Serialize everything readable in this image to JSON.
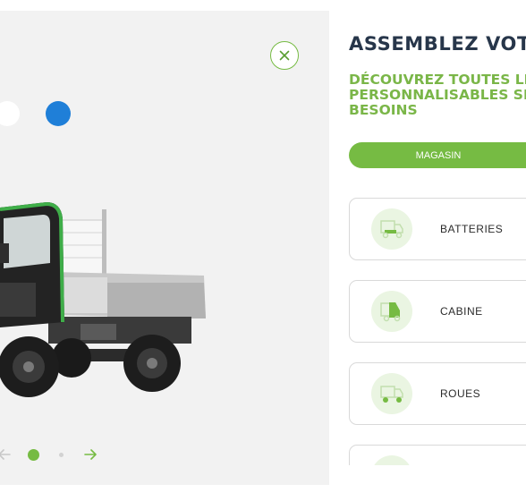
{
  "configurator": {
    "title": "ASSEMBLEZ VOTRE",
    "subtitle_lines": [
      "DÉCOUVREZ TOUTES LES OPTIONS",
      "PERSONNALISABLES SELON VOS",
      "BESOINS"
    ],
    "store_button_label": "MAGASIN",
    "options": [
      {
        "label": "BATTERIES",
        "icon": "battery-truck-icon"
      },
      {
        "label": "CABINE",
        "icon": "cabin-icon"
      },
      {
        "label": "ROUES",
        "icon": "wheels-icon"
      },
      {
        "label": "",
        "icon": "option-icon"
      }
    ]
  },
  "viewer": {
    "close_icon": "close-icon",
    "colors": [
      {
        "name": "white",
        "value": "#ffffff"
      },
      {
        "name": "blue",
        "value": "#1f7fd8"
      }
    ],
    "slider": {
      "current": 1,
      "total": 2
    },
    "prev_icon": "arrow-left-icon",
    "next_icon": "arrow-right-icon"
  },
  "theme": {
    "accent": "#76bb43",
    "accent_light": "#eaf5e2",
    "heading": "#27364a",
    "panel_bg": "#f2f2f2"
  }
}
